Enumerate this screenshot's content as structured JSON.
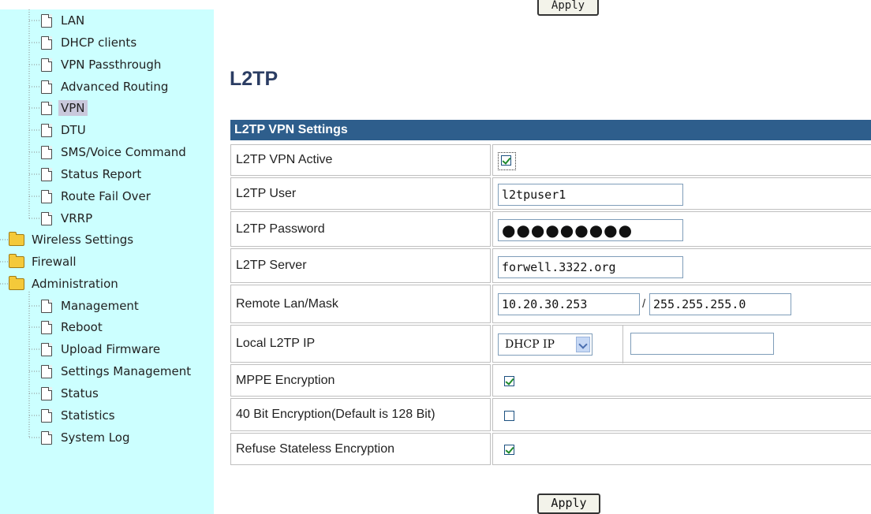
{
  "sidebar": {
    "items": [
      {
        "label": "LAN",
        "type": "doc"
      },
      {
        "label": "DHCP clients",
        "type": "doc"
      },
      {
        "label": "VPN Passthrough",
        "type": "doc"
      },
      {
        "label": "Advanced Routing",
        "type": "doc"
      },
      {
        "label": "VPN",
        "type": "doc",
        "selected": true
      },
      {
        "label": "DTU",
        "type": "doc"
      },
      {
        "label": "SMS/Voice Command",
        "type": "doc"
      },
      {
        "label": "Status Report",
        "type": "doc"
      },
      {
        "label": "Route Fail Over",
        "type": "doc"
      },
      {
        "label": "VRRP",
        "type": "doc"
      },
      {
        "label": "Wireless Settings",
        "type": "folder"
      },
      {
        "label": "Firewall",
        "type": "folder"
      },
      {
        "label": "Administration",
        "type": "folder-open"
      },
      {
        "label": "Management",
        "type": "doc"
      },
      {
        "label": "Reboot",
        "type": "doc"
      },
      {
        "label": "Upload Firmware",
        "type": "doc"
      },
      {
        "label": "Settings Management",
        "type": "doc"
      },
      {
        "label": "Status",
        "type": "doc"
      },
      {
        "label": "Statistics",
        "type": "doc"
      },
      {
        "label": "System Log",
        "type": "doc"
      }
    ]
  },
  "top_apply_label": "Apply",
  "page_title": "L2TP",
  "table": {
    "header": "L2TP VPN Settings",
    "rows": {
      "active": {
        "label": "L2TP VPN Active",
        "checked": true
      },
      "user": {
        "label": "L2TP User",
        "value": "l2tpuser1"
      },
      "password": {
        "label": "L2TP Password",
        "value": "●●●●●●●●●"
      },
      "server": {
        "label": "L2TP Server",
        "value": "forwell.3322.org"
      },
      "remote": {
        "label": "Remote Lan/Mask",
        "lan": "10.20.30.253",
        "separator": "/",
        "mask": "255.255.255.0"
      },
      "local_ip": {
        "label": "Local L2TP IP",
        "mode": "DHCP IP",
        "value": ""
      },
      "mppe": {
        "label": "MPPE Encryption",
        "checked": true
      },
      "bit40": {
        "label": "40 Bit Encryption(Default is 128 Bit)",
        "checked": false
      },
      "stateless": {
        "label": "Refuse Stateless Encryption",
        "checked": true
      }
    }
  },
  "apply_label": "Apply",
  "colors": {
    "sidebar_bg": "#ccffff",
    "header_bg": "#2e5e8c",
    "title": "#2b3d63",
    "check": "#1f8a2b"
  }
}
